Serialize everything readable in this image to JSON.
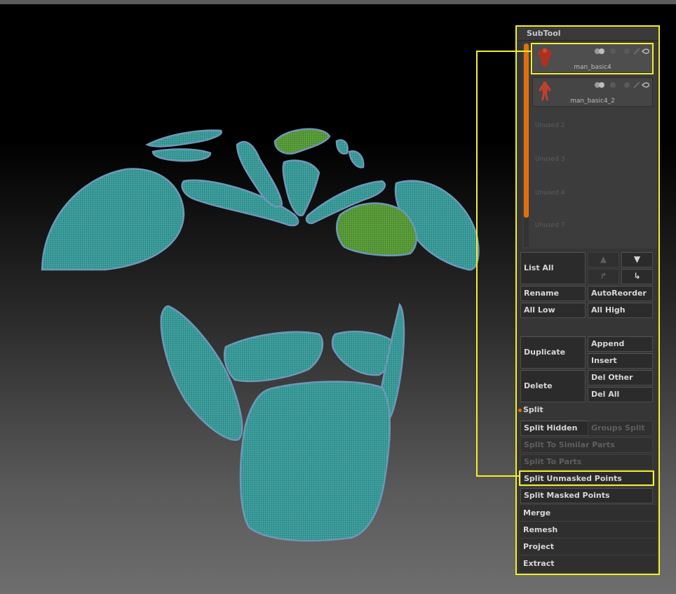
{
  "panel": {
    "title": "SubTool"
  },
  "subtools": [
    {
      "name": "man_basic4",
      "active": true
    },
    {
      "name": "man_basic4_2",
      "active": false
    }
  ],
  "unused": [
    "Unused 2",
    "Unused 3",
    "Unused 4",
    "Unused 7"
  ],
  "buttons": {
    "list_all": "List All",
    "rename": "Rename",
    "auto_reorder": "AutoReorder",
    "all_low": "All Low",
    "all_high": "All High",
    "duplicate": "Duplicate",
    "append": "Append",
    "insert": "Insert",
    "delete": "Delete",
    "del_other": "Del Other",
    "del_all": "Del All"
  },
  "split": {
    "label": "Split",
    "split_hidden": "Split Hidden",
    "groups_split": "Groups Split",
    "split_similar": "Split To Similar Parts",
    "split_parts": "Split To Parts",
    "split_unmasked": "Split Unmasked Points",
    "split_masked": "Split Masked Points"
  },
  "menus": [
    "Merge",
    "Remesh",
    "Project",
    "Extract"
  ],
  "colors": {
    "highlight": "#f2ef2a",
    "accent_orange": "#e07010",
    "mesh_teal": "#3fa8a8",
    "mesh_green": "#5a9e3c",
    "panel_bg": "#363636"
  },
  "icons": {
    "up_arrow": "arrow-up-icon",
    "down_arrow": "arrow-down-icon",
    "move_right": "arrow-turn-right-icon",
    "move_down_right": "arrow-turn-down-right-icon",
    "eye": "eye-icon"
  }
}
